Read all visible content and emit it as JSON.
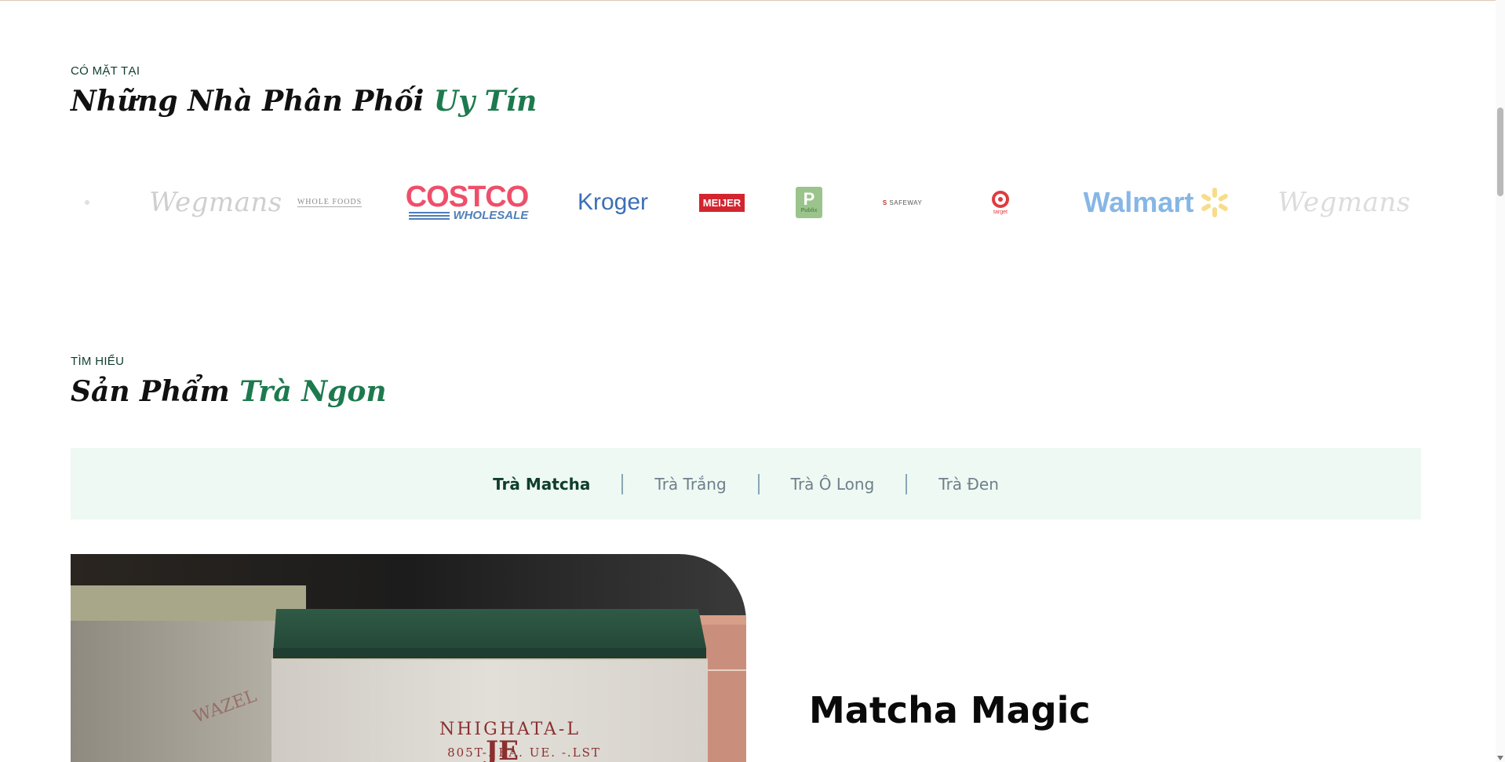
{
  "distributors": {
    "eyebrow": "CÓ MẶT TẠI",
    "title_main": "Những Nhà Phân Phối",
    "title_accent": "Uy Tín",
    "logos": {
      "wegmans": "Wegmans",
      "wholefoods": "WHOLE FOODS",
      "costco": "COSTCO",
      "costco_sub": "WHOLESALE",
      "kroger": "Kroger",
      "meijer": "MEIJER",
      "publix": "P",
      "publix_sub": "Publix",
      "safeway_prefix": "S",
      "safeway": "SAFEWAY",
      "target": "target",
      "walmart": "Walmart",
      "wegmans_repeat": "Wegmans"
    }
  },
  "products": {
    "eyebrow": "TÌM HIỂU",
    "title_main": "Sản Phẩm",
    "title_accent": "Trà Ngon",
    "tabs": [
      "Trà Matcha",
      "Trà Trắng",
      "Trà Ô Long",
      "Trà Đen"
    ],
    "active_tab": "Trà Matcha",
    "featured_title": "Matcha Magic",
    "image_print": {
      "arc": "NHIGHATA-L",
      "line": "805T-. EA. UE. -.LST",
      "mark": "JE"
    }
  },
  "colors": {
    "accent_green": "#1d7a4e",
    "dark_green": "#0f3d2e",
    "tab_bg": "#edf9f2",
    "tab_inactive": "#6f7f8c"
  }
}
